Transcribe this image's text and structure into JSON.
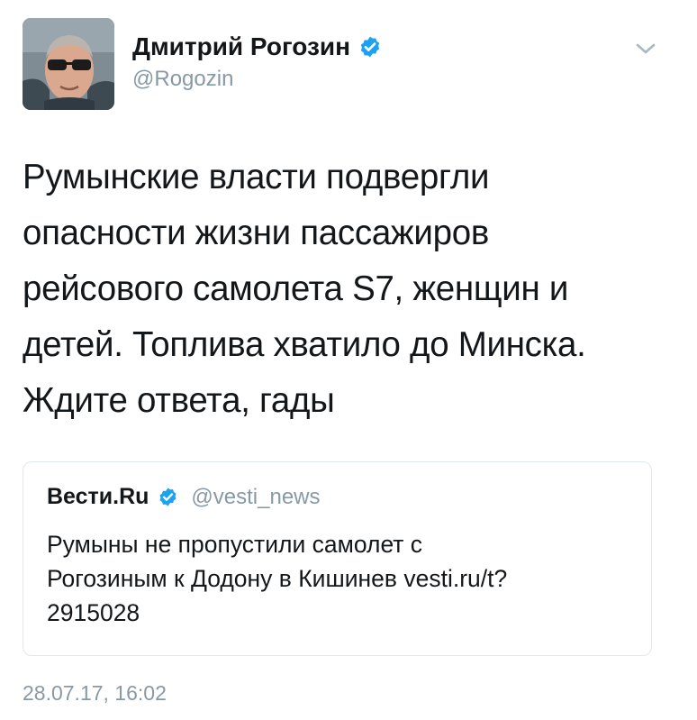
{
  "author": {
    "name": "Дмитрий Рогозин",
    "handle": "@Rogozin",
    "verified": true
  },
  "tweet": {
    "lines": [
      "Румынские власти подвергли",
      "опасности жизни пассажиров",
      "рейсового самолета S7, женщин и",
      "детей. Топлива хватило до Минска.",
      "Ждите ответа, гады"
    ]
  },
  "quoted_tweet": {
    "name": "Вести.Ru",
    "handle": "@vesti_news",
    "verified": true,
    "lines": [
      "Румыны не пропустили самолет с",
      "Рогозиным к Додону в Кишинев vesti.ru/t?",
      "2915028"
    ]
  },
  "timestamp": "28.07.17, 16:02",
  "icons": {
    "verified": "verified-badge-icon",
    "menu": "chevron-down-icon"
  },
  "colors": {
    "verified_blue": "#1da1f2",
    "secondary_text": "#8899a6",
    "primary_text": "#14171a",
    "border": "#e1e8ed"
  }
}
